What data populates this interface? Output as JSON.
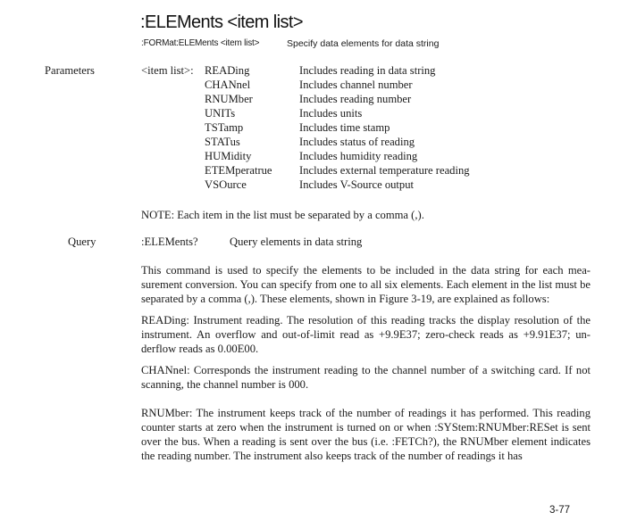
{
  "header": {
    "title": ":ELEMents  <item list>",
    "command": ":FORMat:ELEMents  <item list>",
    "description": "Specify data elements for data string"
  },
  "parameters": {
    "label": "Parameters",
    "item_list_label": "<item list>:",
    "items": [
      {
        "name": "READing",
        "desc": "Includes reading in data string"
      },
      {
        "name": "CHANnel",
        "desc": "Includes channel number"
      },
      {
        "name": "RNUMber",
        "desc": "Includes reading number"
      },
      {
        "name": "UNITs",
        "desc": "Includes units"
      },
      {
        "name": "TSTamp",
        "desc": "Includes time stamp"
      },
      {
        "name": "STATus",
        "desc": "Includes status of reading"
      },
      {
        "name": "HUMidity",
        "desc": "Includes humidity reading"
      },
      {
        "name": "ETEMperatrue",
        "desc": "Includes external temperature reading"
      },
      {
        "name": "VSOurce",
        "desc": "Includes V-Source output"
      }
    ],
    "note": "NOTE: Each item in the list must be separated by a comma (,)."
  },
  "query": {
    "label": "Query",
    "command": ":ELEMents?",
    "description": "Query elements in data string"
  },
  "body": {
    "paragraphs": [
      "This command is used to specify the elements to be included in the data string for each mea­surement conversion. You can specify from one to all six elements. Each element in the list must be separated by a comma (,). These elements, shown in Figure 3-19, are explained as follows:",
      "READing: Instrument reading. The resolution of this reading tracks the display resolution of the instrument. An overflow and out-of-limit read as +9.9E37; zero-check reads as +9.91E37; un­derflow reads as 0.00E00.",
      "CHANnel: Corresponds the instrument reading to the channel number of a switching card. If not scanning, the channel number is 000.",
      "RNUMber: The instrument keeps track of the number of readings it has performed. This reading counter starts at zero when the instrument is turned on or when :SYStem:RNUMber:RESet is sent over the bus. When a reading is sent over the bus (i.e. :FETCh?), the RNUMber element indicates the reading number. The instrument also keeps track of the number of readings it has"
    ]
  },
  "footer": {
    "page_number": "3-77"
  }
}
